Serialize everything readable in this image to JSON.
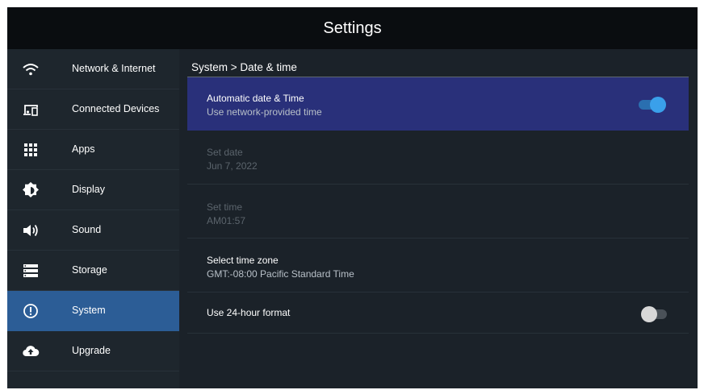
{
  "title": "Settings",
  "sidebar": {
    "items": [
      {
        "label": "Network & Internet",
        "icon": "wifi-icon"
      },
      {
        "label": "Connected Devices",
        "icon": "devices-icon"
      },
      {
        "label": "Apps",
        "icon": "apps-grid-icon"
      },
      {
        "label": "Display",
        "icon": "brightness-icon"
      },
      {
        "label": "Sound",
        "icon": "speaker-icon"
      },
      {
        "label": "Storage",
        "icon": "storage-icon"
      },
      {
        "label": "System",
        "icon": "info-circle-icon",
        "active": true
      },
      {
        "label": "Upgrade",
        "icon": "cloud-upload-icon"
      }
    ]
  },
  "main": {
    "breadcrumb": "System > Date & time",
    "rows": [
      {
        "title": "Automatic date & Time",
        "subtitle": "Use network-provided time",
        "toggle": "on",
        "selected": true
      },
      {
        "title": "Set date",
        "subtitle": "Jun 7, 2022",
        "disabled": true
      },
      {
        "title": "Set time",
        "subtitle": "AM01:57",
        "disabled": true
      },
      {
        "title": "Select time zone",
        "subtitle": "GMT:-08:00 Pacific Standard Time"
      },
      {
        "title": "Use 24-hour format",
        "toggle": "off"
      }
    ]
  },
  "colors": {
    "accent_active": "#2c5d96",
    "selected_row": "#29307a",
    "toggle_on": "#3aa0ea"
  }
}
